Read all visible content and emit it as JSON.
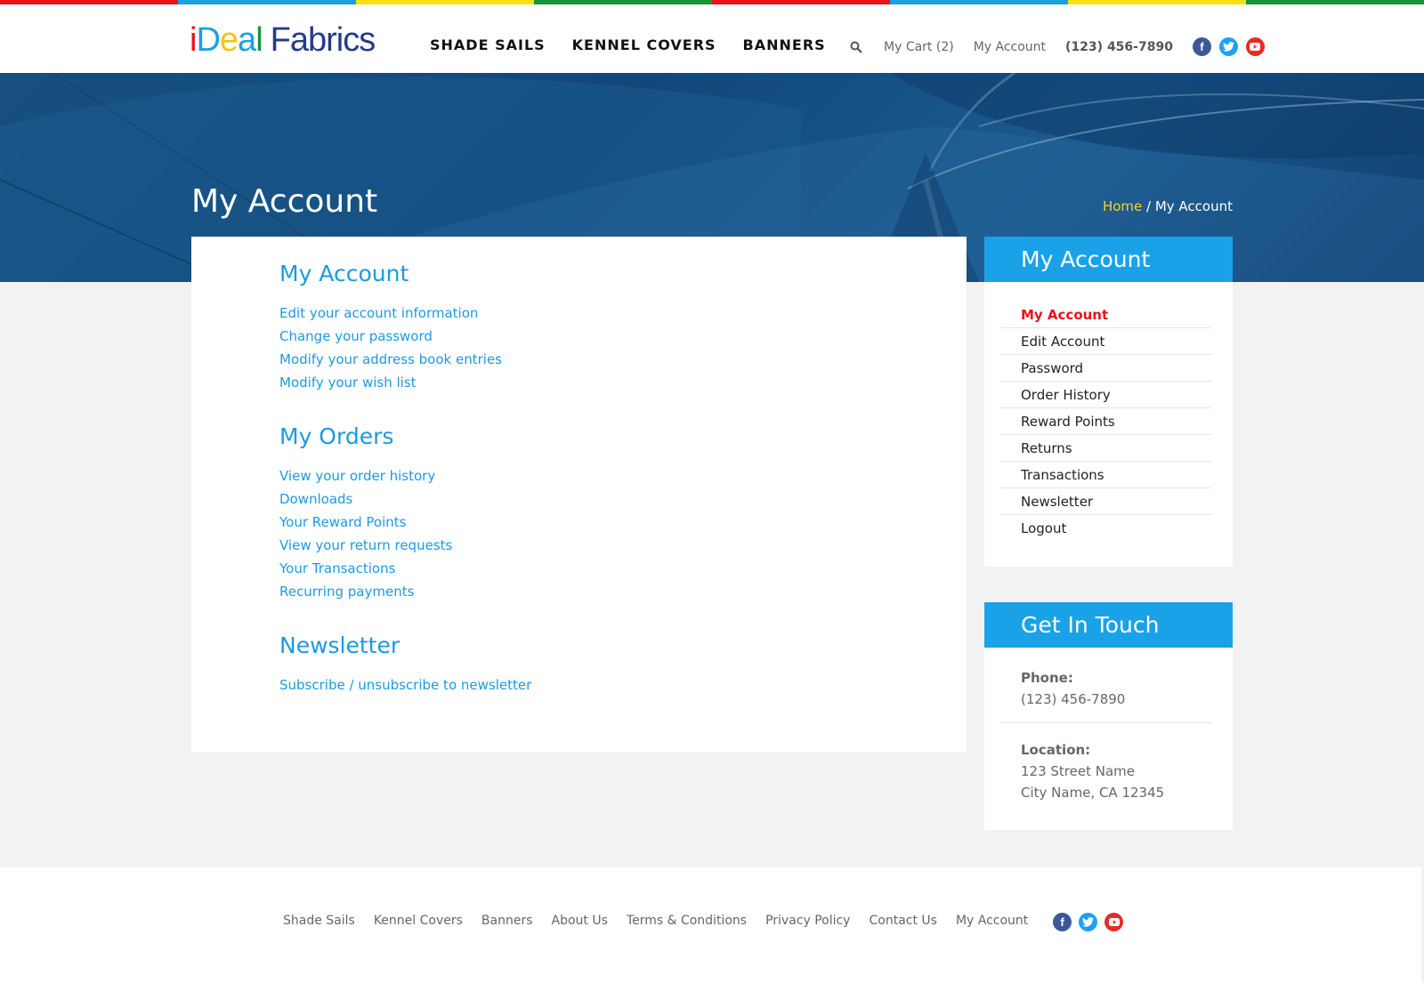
{
  "brand": {
    "logo_parts": [
      "i",
      "D",
      "e",
      "a",
      "l",
      "Fabrics"
    ],
    "colors": {
      "red": "#e8131b",
      "blue": "#1ba0e2",
      "yellow": "#f6c40f",
      "green": "#16943b",
      "navy": "#243a8b",
      "accent": "#1aa2e8",
      "active": "#e3141b"
    }
  },
  "color_strip": [
    "#e8131b",
    "#1ba0e2",
    "#f6e117",
    "#16943b",
    "#e8131b",
    "#1ba0e2",
    "#f6e117",
    "#16943b"
  ],
  "nav": {
    "items": [
      "SHADE SAILS",
      "KENNEL COVERS",
      "BANNERS"
    ]
  },
  "utility": {
    "search_icon": "search-icon",
    "cart": "My Cart (2)",
    "account": "My Account",
    "phone": "(123) 456-7890",
    "social": [
      "facebook-icon",
      "twitter-icon",
      "youtube-icon"
    ]
  },
  "banner": {
    "title": "My Account",
    "breadcrumb_home": "Home",
    "breadcrumb_sep": " / ",
    "breadcrumb_current": "My Account"
  },
  "main": {
    "sections": [
      {
        "title": "My Account",
        "links": [
          "Edit your account information",
          "Change your password",
          "Modify your address book entries",
          "Modify your wish list"
        ]
      },
      {
        "title": "My Orders",
        "links": [
          "View your order history",
          "Downloads",
          "Your Reward Points",
          "View your return requests",
          "Your Transactions",
          "Recurring payments"
        ]
      },
      {
        "title": "Newsletter",
        "links": [
          "Subscribe / unsubscribe to newsletter"
        ]
      }
    ]
  },
  "sidebar": {
    "account_title": "My Account",
    "menu": [
      "My Account",
      "Edit Account",
      "Password",
      "Order History",
      "Reward Points",
      "Returns",
      "Transactions",
      "Newsletter",
      "Logout"
    ],
    "active_index": 0,
    "contact_title": "Get In Touch",
    "phone_label": "Phone:",
    "phone_value": "(123) 456-7890",
    "location_label": "Location:",
    "location_line1": "123 Street Name",
    "location_line2": "City Name, CA 12345"
  },
  "footer": {
    "links": [
      "Shade Sails",
      "Kennel Covers",
      "Banners",
      "About Us",
      "Terms & Conditions",
      "Privacy Policy",
      "Contact Us",
      "My Account"
    ],
    "social": [
      "facebook-icon",
      "twitter-icon",
      "youtube-icon"
    ]
  }
}
